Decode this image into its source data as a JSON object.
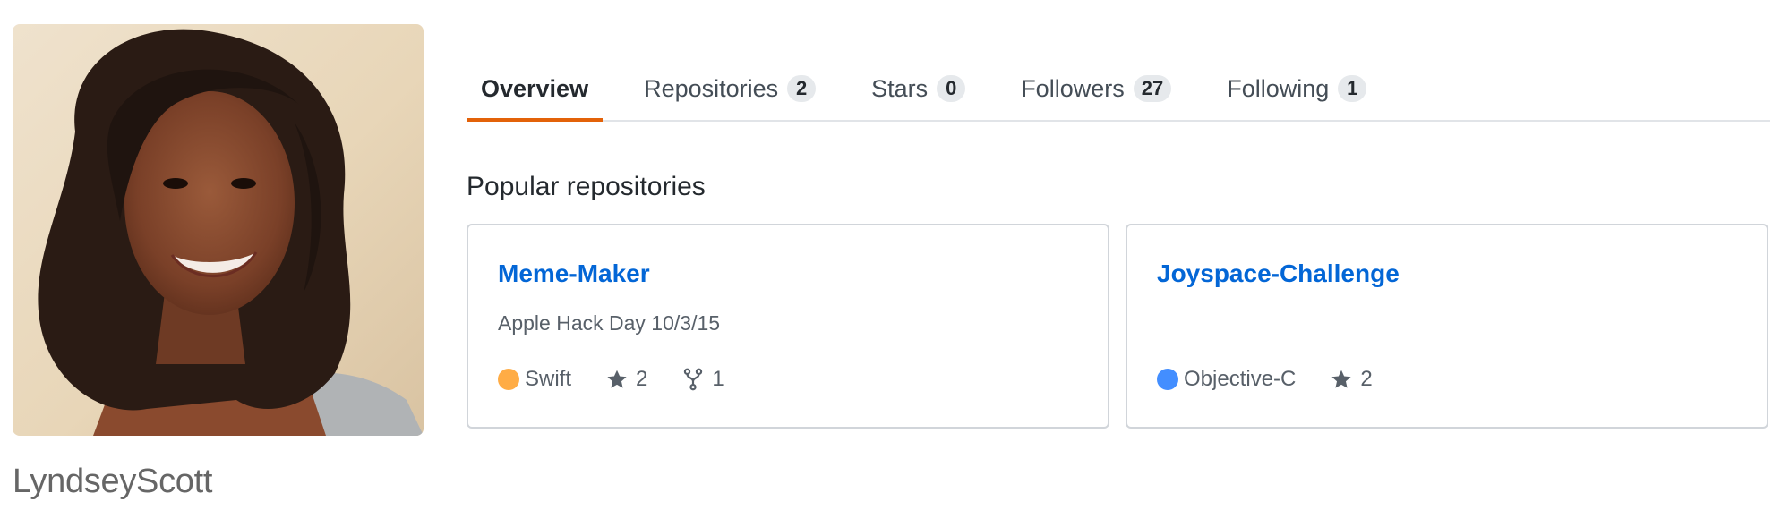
{
  "profile": {
    "username": "LyndseyScott",
    "avatar_alt": "LyndseyScott"
  },
  "tabs": [
    {
      "label": "Overview",
      "count": null,
      "active": true
    },
    {
      "label": "Repositories",
      "count": "2",
      "active": false
    },
    {
      "label": "Stars",
      "count": "0",
      "active": false
    },
    {
      "label": "Followers",
      "count": "27",
      "active": false
    },
    {
      "label": "Following",
      "count": "1",
      "active": false
    }
  ],
  "popular": {
    "title": "Popular repositories",
    "repos": [
      {
        "name": "Meme-Maker",
        "description": "Apple Hack Day 10/3/15",
        "language": "Swift",
        "language_color": "#ffac45",
        "stars": "2",
        "forks": "1"
      },
      {
        "name": "Joyspace-Challenge",
        "description": "",
        "language": "Objective-C",
        "language_color": "#438eff",
        "stars": "2",
        "forks": null
      }
    ]
  },
  "colors": {
    "accent_tab": "#e36209",
    "link": "#0366d6"
  },
  "icons": {
    "star": "star-icon",
    "fork": "repo-forked-icon"
  }
}
